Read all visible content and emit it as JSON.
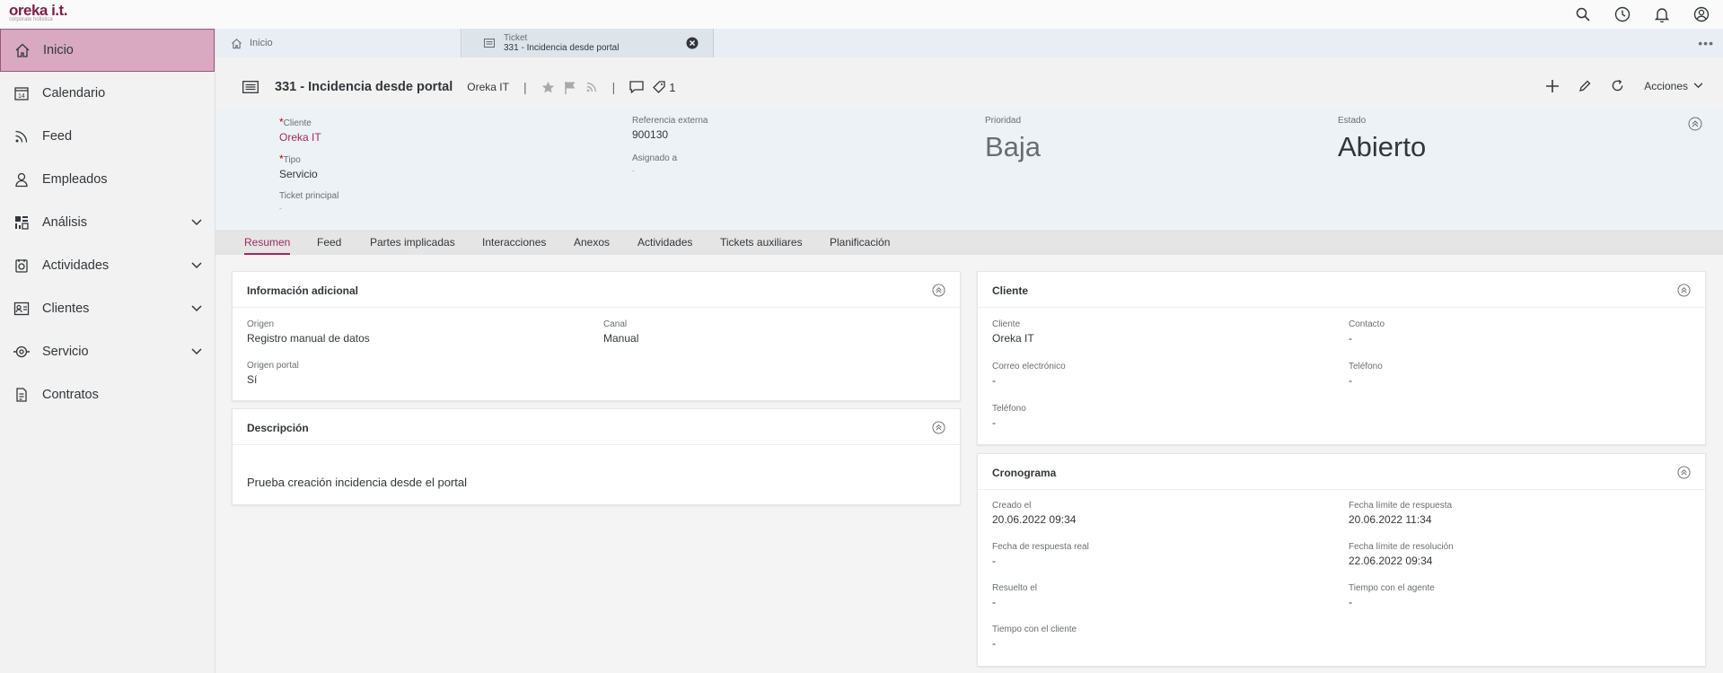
{
  "brand": {
    "logo": "oreka i.t.",
    "subtitle": "corporate holistica"
  },
  "sidebar": {
    "items": [
      {
        "label": "Inicio"
      },
      {
        "label": "Calendario"
      },
      {
        "label": "Feed"
      },
      {
        "label": "Empleados"
      },
      {
        "label": "Análisis"
      },
      {
        "label": "Actividades"
      },
      {
        "label": "Clientes"
      },
      {
        "label": "Servicio"
      },
      {
        "label": "Contratos"
      }
    ]
  },
  "doc_tabs": {
    "home": "Inicio",
    "ticket_kind": "Ticket",
    "ticket_title": "331 - Incidencia desde portal"
  },
  "header": {
    "title": "331 - Incidencia desde portal",
    "org": "Oreka IT",
    "tag_count": "1",
    "actions": "Acciones"
  },
  "facets": {
    "cliente_label": "Cliente",
    "cliente_value": "Oreka IT",
    "tipo_label": "Tipo",
    "tipo_value": "Servicio",
    "ticket_principal_label": "Ticket principal",
    "ticket_principal_value": "-",
    "ref_label": "Referencia externa",
    "ref_value": "900130",
    "asignado_label": "Asignado a",
    "asignado_value": "-",
    "prioridad_label": "Prioridad",
    "prioridad_value": "Baja",
    "estado_label": "Estado",
    "estado_value": "Abierto"
  },
  "tabs": [
    "Resumen",
    "Feed",
    "Partes implicadas",
    "Interacciones",
    "Anexos",
    "Actividades",
    "Tickets auxiliares",
    "Planificación"
  ],
  "info": {
    "title": "Información adicional",
    "origen_label": "Origen",
    "origen_value": "Registro manual de datos",
    "canal_label": "Canal",
    "canal_value": "Manual",
    "portal_label": "Origen portal",
    "portal_value": "Sí"
  },
  "descripcion": {
    "title": "Descripción",
    "text": "Prueba creación incidencia desde el portal"
  },
  "cliente_card": {
    "title": "Cliente",
    "cliente_label": "Cliente",
    "cliente_value": "Oreka IT",
    "contacto_label": "Contacto",
    "contacto_value": "-",
    "correo_label": "Correo electrónico",
    "correo_value": "-",
    "telefono1_label": "Teléfono",
    "telefono1_value": "-",
    "telefono2_label": "Teléfono",
    "telefono2_value": "-"
  },
  "cronograma": {
    "title": "Cronograma",
    "creado_label": "Creado el",
    "creado_value": "20.06.2022 09:34",
    "limite_resp_label": "Fecha límite de respuesta",
    "limite_resp_value": "20.06.2022 11:34",
    "resp_real_label": "Fecha de respuesta real",
    "resp_real_value": "-",
    "limite_resol_label": "Fecha límite de resolución",
    "limite_resol_value": "22.06.2022 09:34",
    "resuelto_label": "Resuelto el",
    "resuelto_value": "-",
    "agente_label": "Tiempo con el agente",
    "agente_value": "-",
    "cliente_t_label": "Tiempo con el cliente",
    "cliente_t_value": "-"
  },
  "icons": [
    "search-icon",
    "history-icon",
    "bell-icon",
    "user-icon",
    "home-icon",
    "calendar-icon",
    "feed-icon",
    "person-icon",
    "chart-icon",
    "activity-icon",
    "customers-icon",
    "service-icon",
    "contract-icon"
  ],
  "colors": {
    "accent": "#9b2b5e",
    "active_nav": "#d8a9c0"
  }
}
